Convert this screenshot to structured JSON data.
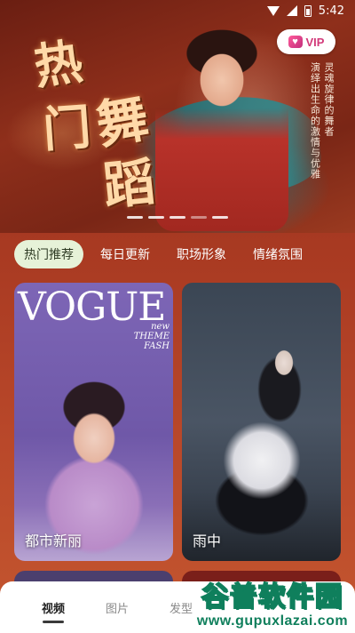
{
  "status_bar": {
    "time": "5:42"
  },
  "banner": {
    "title_chars": [
      "热",
      "门",
      "舞",
      "蹈"
    ],
    "slogan_columns": [
      "灵魂旋律的舞者",
      "演绎出生命的激情与优雅"
    ],
    "vip_label": "VIP",
    "carousel_pages": 5,
    "carousel_active_index": 0
  },
  "tabs": [
    {
      "label": "热门推荐",
      "active": true
    },
    {
      "label": "每日更新",
      "active": false
    },
    {
      "label": "职场形象",
      "active": false
    },
    {
      "label": "情绪氛围",
      "active": false
    }
  ],
  "cards": [
    {
      "label": "都市新丽",
      "magazine_title": "VOGUE",
      "magazine_sub": "new\nTHEME\nFASH"
    },
    {
      "label": "雨中"
    }
  ],
  "bottom_nav": [
    {
      "label": "视频",
      "active": true
    },
    {
      "label": "图片",
      "active": false
    },
    {
      "label": "发型",
      "active": false
    }
  ],
  "watermark": {
    "top": "谷普软件园",
    "bottom": "www.gupuxlazai.com"
  },
  "colors": {
    "accent_tab_bg": "#e6f2d8",
    "vip_pink": "#d23a7a",
    "watermark_green": "#0f7f5c",
    "page_bg": "#a93a22"
  }
}
